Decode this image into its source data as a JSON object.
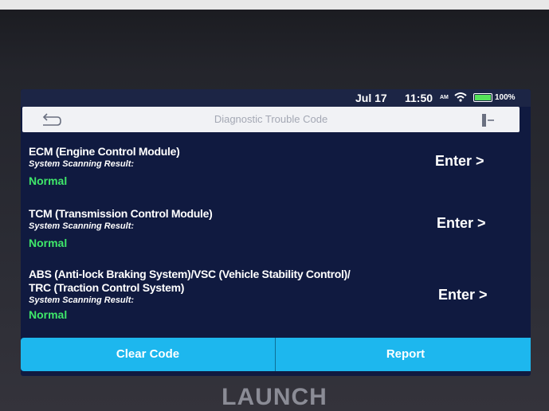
{
  "statusbar": {
    "date": "Jul 17",
    "time": "11:50",
    "network": "AM",
    "battery": "100%"
  },
  "header": {
    "title": "Diagnostic Trouble Code"
  },
  "modules": [
    {
      "name": "ECM (Engine Control Module)",
      "subtitle": "System Scanning Result:",
      "result": "Normal",
      "action": "Enter >"
    },
    {
      "name": "TCM (Transmission Control Module)",
      "subtitle": "System Scanning Result:",
      "result": "Normal",
      "action": "Enter >"
    },
    {
      "name": "ABS (Anti-lock Braking System)/VSC (Vehicle Stability Control)/",
      "name2": "TRC (Traction Control System)",
      "subtitle": "System Scanning Result:",
      "result": "Normal",
      "action": "Enter >"
    }
  ],
  "footer": {
    "clear_label": "Clear Code",
    "report_label": "Report"
  },
  "brand": "LAUNCH",
  "colors": {
    "accent": "#1db7ee",
    "normal": "#3fe86a",
    "background": "#101a40"
  }
}
